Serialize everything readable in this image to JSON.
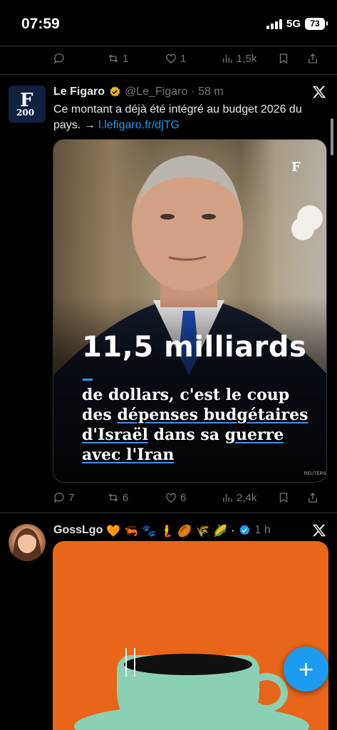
{
  "status_bar": {
    "time": "07:59",
    "network": "5G",
    "battery": "73"
  },
  "prev_actions": {
    "replies": "",
    "reposts": "1",
    "likes": "1",
    "views": "1,5k"
  },
  "tweet": {
    "name": "Le Figaro",
    "handle": "@Le_Figaro",
    "time": "· 58 m",
    "text": "Ce montant a déjà été intégré au budget 2026 du pays. → ",
    "link": "l.lefigaro.fr/djTG",
    "avatar_letter": "F",
    "avatar_number": "200",
    "media": {
      "logo": "F",
      "headline": "11,5 milliards",
      "sub_line1": "de dollars, c'est le coup",
      "sub_line2_a": "des ",
      "sub_line2_b": "dépenses budgétaires",
      "sub_line3_a": "d'Israël",
      "sub_line3_b": " dans sa ",
      "sub_line3_c": "guerre",
      "sub_line4": "avec l'Iran",
      "credit": "REUTERS"
    },
    "actions": {
      "replies": "7",
      "reposts": "6",
      "likes": "6",
      "views": "2,4k"
    }
  },
  "tweet2": {
    "name": "GossLgo",
    "emojis": "🧡 🦐 🐾 🧜 🏉 🌾 🌽 ·",
    "time": "1 h"
  },
  "fab": {
    "label": "+"
  },
  "colors": {
    "accent": "#1d9bf0",
    "verified_gold": "#e2b719",
    "background": "#000000",
    "muted": "#71767b"
  }
}
